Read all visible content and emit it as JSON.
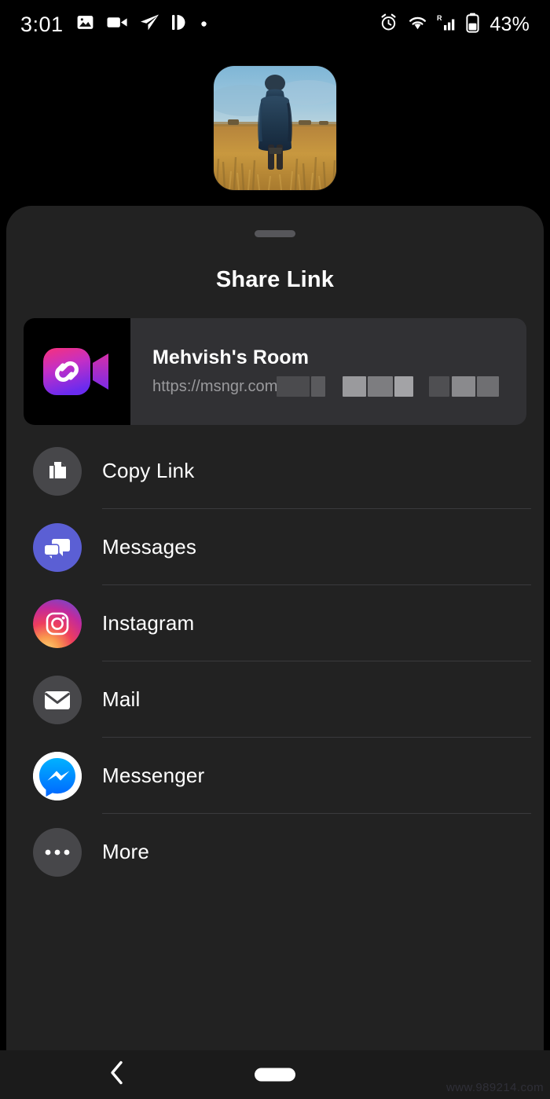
{
  "status_bar": {
    "time": "3:01",
    "battery_percent": "43%",
    "left_icons": [
      "photo-icon",
      "video-camera-icon",
      "telegram-send-icon",
      "contrast-split-icon",
      "dot-icon"
    ],
    "right_icons": [
      "alarm-clock-icon",
      "wifi-icon",
      "roaming-signal-icon",
      "battery-icon"
    ]
  },
  "hero": {
    "icon_name": "shared-photo-thumbnail",
    "description": "Person in navy jacket standing in golden wheat field under blue sky"
  },
  "sheet": {
    "title": "Share Link",
    "grabber_name": "sheet-drag-handle"
  },
  "link_card": {
    "icon_name": "messenger-rooms-link-icon",
    "title": "Mehvish's Room",
    "url": "https://msngr.com",
    "url_redacted": true
  },
  "share_targets": [
    {
      "label": "Copy Link",
      "icon": "copy-link-icon",
      "divider": true
    },
    {
      "label": "Messages",
      "icon": "messages-icon",
      "divider": true
    },
    {
      "label": "Instagram",
      "icon": "instagram-icon",
      "divider": true
    },
    {
      "label": "Mail",
      "icon": "mail-icon",
      "divider": true
    },
    {
      "label": "Messenger",
      "icon": "messenger-icon",
      "divider": true
    },
    {
      "label": "More",
      "icon": "more-dots-icon",
      "divider": false
    }
  ],
  "nav_bar": {
    "back_icon": "back-chevron-icon",
    "home_pill": "home-indicator-pill"
  },
  "watermark": {
    "text": "www.989214.com"
  },
  "colors": {
    "screen_bg": "#000000",
    "sheet_bg": "#222222",
    "card_bg": "#313134",
    "divider": "#3a3a3d",
    "text_primary": "#ffffff",
    "text_secondary": "#9a9a9d",
    "gray_icon_circle": "#47474a",
    "messages_blue": "#5B5FD4",
    "messenger_blue": "#0A99FF",
    "rooms_pink": "#F0317E",
    "rooms_purple": "#8A2BE2"
  }
}
